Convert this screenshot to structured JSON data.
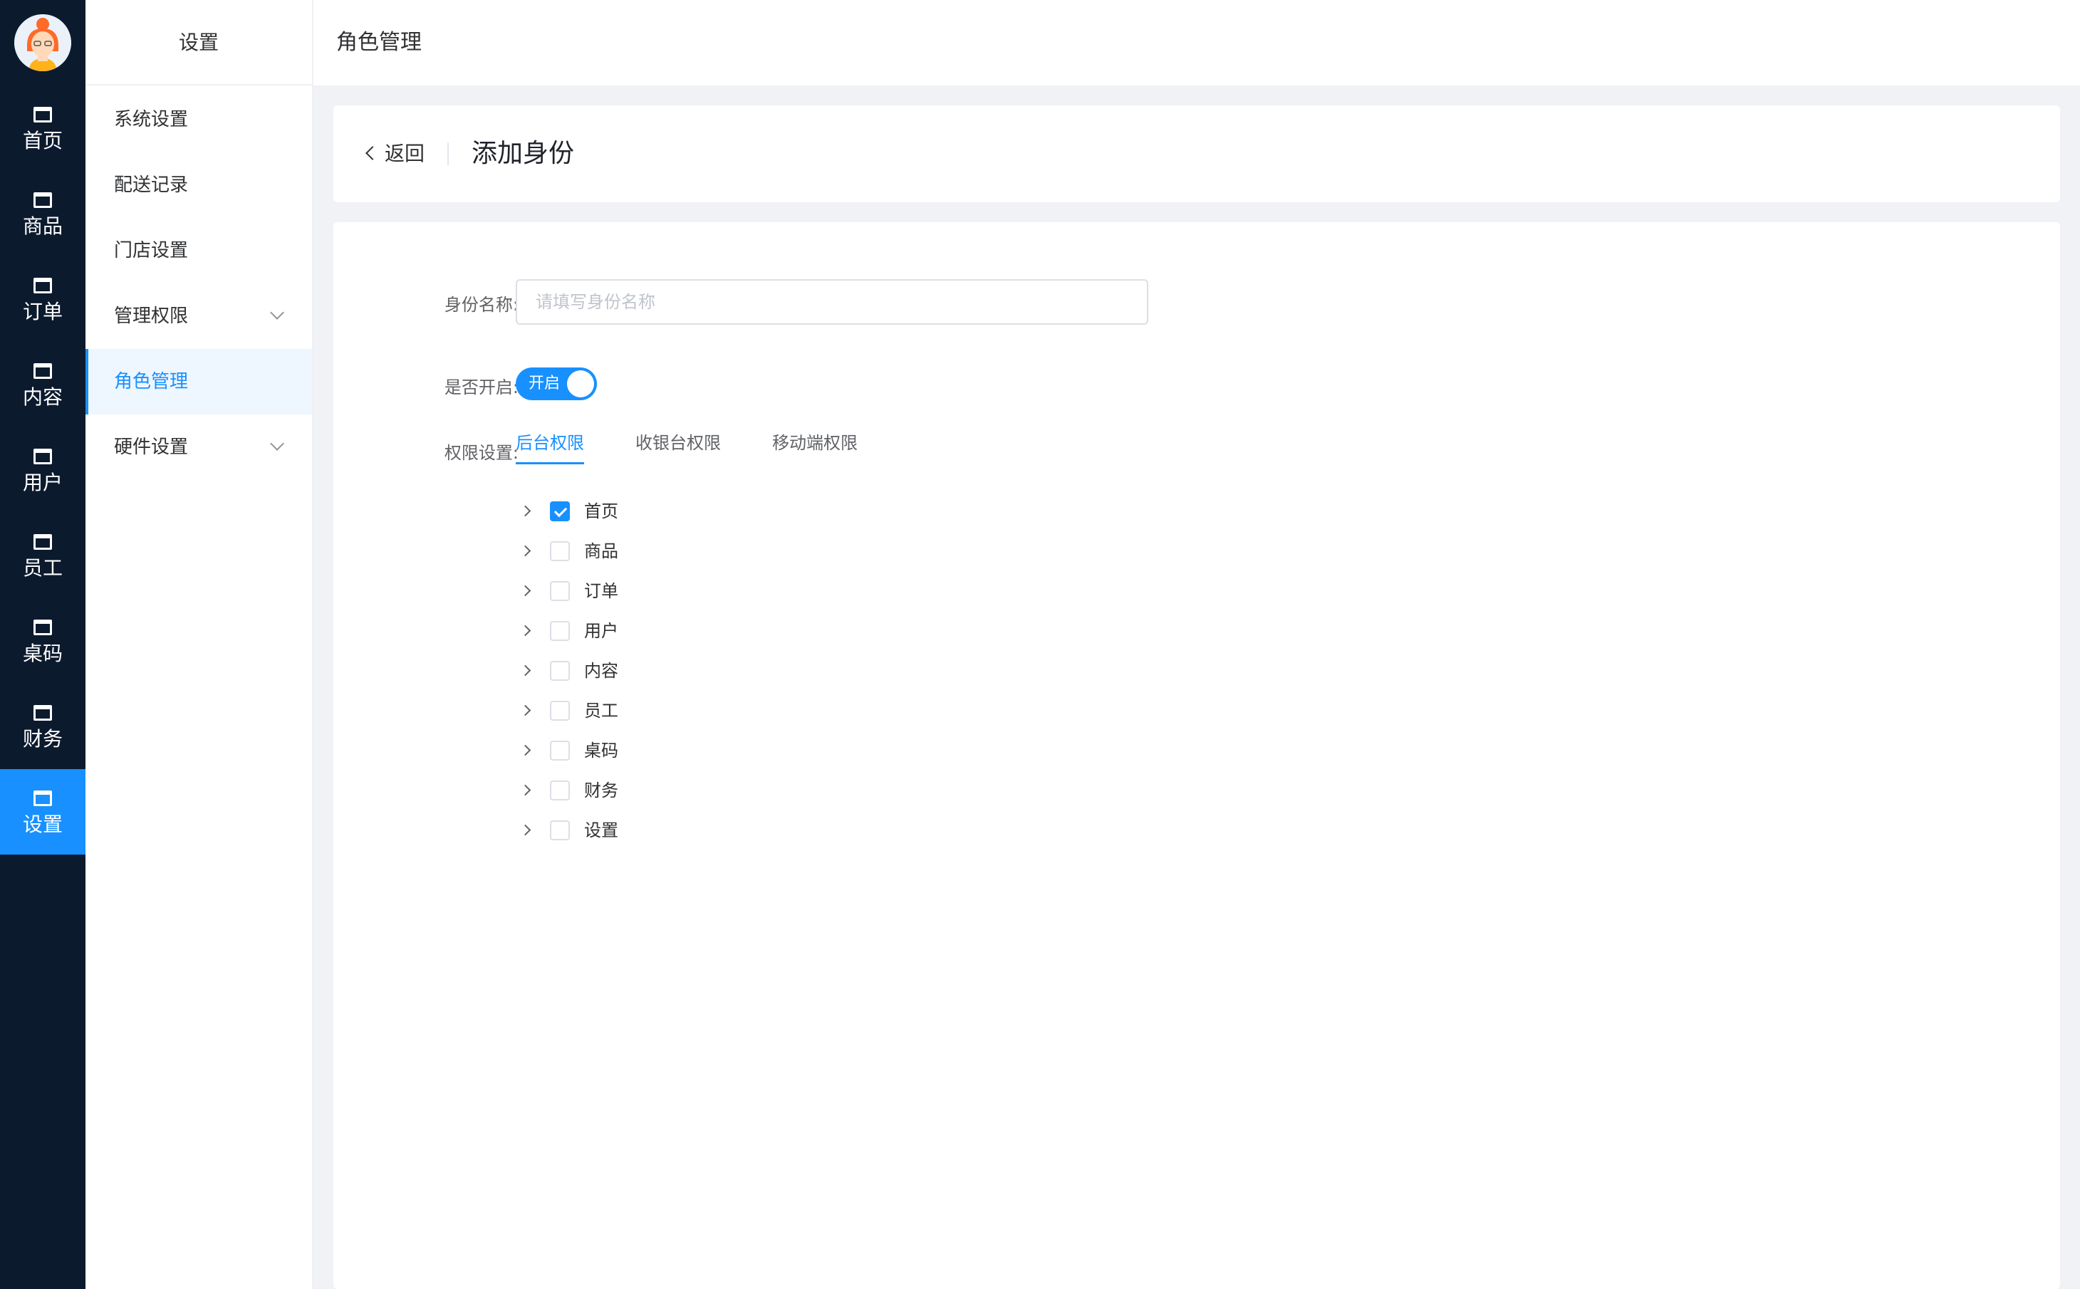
{
  "rail": {
    "avatar_icon": "user-avatar-icon",
    "items": [
      {
        "label": "首页",
        "icon": "window-icon"
      },
      {
        "label": "商品",
        "icon": "window-icon"
      },
      {
        "label": "订单",
        "icon": "window-icon"
      },
      {
        "label": "内容",
        "icon": "window-icon"
      },
      {
        "label": "用户",
        "icon": "window-icon"
      },
      {
        "label": "员工",
        "icon": "window-icon"
      },
      {
        "label": "桌码",
        "icon": "window-icon"
      },
      {
        "label": "财务",
        "icon": "window-icon"
      },
      {
        "label": "设置",
        "icon": "window-icon",
        "active": true
      }
    ],
    "active_color": "#1890ff",
    "background": "#0c1a2e"
  },
  "submenu": {
    "title": "设置",
    "items": [
      {
        "label": "系统设置"
      },
      {
        "label": "配送记录"
      },
      {
        "label": "门店设置"
      },
      {
        "label": "管理权限",
        "expandable": true
      },
      {
        "label": "角色管理",
        "active": true
      },
      {
        "label": "硬件设置",
        "expandable": true
      }
    ]
  },
  "header": {
    "title": "角色管理"
  },
  "page_head": {
    "back_label": "返回",
    "title": "添加身份"
  },
  "form": {
    "name_label": "身份名称:",
    "name_placeholder": "请填写身份名称",
    "name_value": "",
    "enable_label": "是否开启:",
    "switch_text": "开启",
    "switch_on": true,
    "permission_label": "权限设置:",
    "tabs": [
      {
        "label": "后台权限",
        "active": true
      },
      {
        "label": "收银台权限"
      },
      {
        "label": "移动端权限"
      }
    ],
    "tree": [
      {
        "label": "首页",
        "checked": true
      },
      {
        "label": "商品",
        "checked": false
      },
      {
        "label": "订单",
        "checked": false
      },
      {
        "label": "用户",
        "checked": false
      },
      {
        "label": "内容",
        "checked": false
      },
      {
        "label": "员工",
        "checked": false
      },
      {
        "label": "桌码",
        "checked": false
      },
      {
        "label": "财务",
        "checked": false
      },
      {
        "label": "设置",
        "checked": false
      }
    ]
  },
  "colors": {
    "primary": "#1890ff",
    "page_bg": "#f0f2f5"
  }
}
